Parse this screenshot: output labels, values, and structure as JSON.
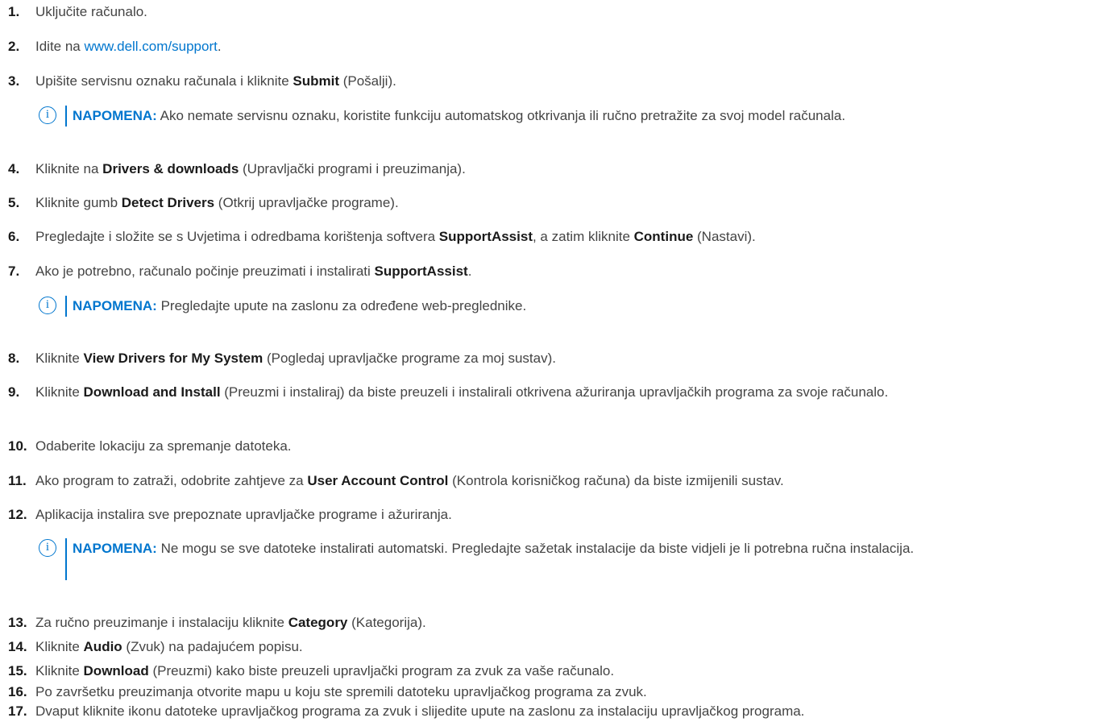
{
  "steps": [
    {
      "num": "1.",
      "parts": [
        {
          "t": "Uključite računalo."
        }
      ]
    },
    {
      "num": "2.",
      "parts": [
        {
          "t": "Idite na "
        },
        {
          "t": "www.dell.com/support",
          "s": "link"
        },
        {
          "t": "."
        }
      ]
    },
    {
      "num": "3.",
      "parts": [
        {
          "t": "Upišite servisnu oznaku računala i kliknite "
        },
        {
          "t": "Submit",
          "s": "b"
        },
        {
          "t": " (Pošalji)."
        }
      ]
    },
    {
      "num": "4.",
      "parts": [
        {
          "t": "Kliknite na "
        },
        {
          "t": "Drivers & downloads",
          "s": "b"
        },
        {
          "t": " (Upravljački programi i preuzimanja)."
        }
      ]
    },
    {
      "num": "5.",
      "parts": [
        {
          "t": "Kliknite gumb "
        },
        {
          "t": "Detect Drivers",
          "s": "b"
        },
        {
          "t": " (Otkrij upravljačke programe)."
        }
      ]
    },
    {
      "num": "6.",
      "parts": [
        {
          "t": "Pregledajte i složite se s Uvjetima i odredbama korištenja softvera "
        },
        {
          "t": "SupportAssist",
          "s": "b"
        },
        {
          "t": ", a zatim kliknite "
        },
        {
          "t": "Continue",
          "s": "b"
        },
        {
          "t": " (Nastavi)."
        }
      ]
    },
    {
      "num": "7.",
      "parts": [
        {
          "t": "Ako je potrebno, računalo počinje preuzimati i instalirati "
        },
        {
          "t": "SupportAssist",
          "s": "b"
        },
        {
          "t": "."
        }
      ]
    },
    {
      "num": "8.",
      "parts": [
        {
          "t": "Kliknite "
        },
        {
          "t": "View Drivers for My System",
          "s": "b"
        },
        {
          "t": " (Pogledaj upravljačke programe za moj sustav)."
        }
      ]
    },
    {
      "num": "9.",
      "parts": [
        {
          "t": "Kliknite "
        },
        {
          "t": "Download and Install",
          "s": "b"
        },
        {
          "t": " (Preuzmi i instaliraj) da biste preuzeli i instalirali otkrivena ažuriranja upravljačkih programa za svoje računalo."
        }
      ]
    },
    {
      "num": "10.",
      "parts": [
        {
          "t": "Odaberite lokaciju za spremanje datoteka."
        }
      ]
    },
    {
      "num": "11.",
      "parts": [
        {
          "t": "Ako program to zatraži, odobrite zahtjeve za "
        },
        {
          "t": "User Account Control",
          "s": "b"
        },
        {
          "t": " (Kontrola korisničkog računa) da biste izmijenili sustav."
        }
      ]
    },
    {
      "num": "12.",
      "parts": [
        {
          "t": "Aplikacija instalira sve prepoznate upravljačke programe i ažuriranja."
        }
      ]
    },
    {
      "num": "13.",
      "parts": [
        {
          "t": "Za ručno preuzimanje i instalaciju kliknite "
        },
        {
          "t": "Category",
          "s": "b"
        },
        {
          "t": " (Kategorija)."
        }
      ]
    },
    {
      "num": "14.",
      "parts": [
        {
          "t": "Kliknite "
        },
        {
          "t": "Audio",
          "s": "b"
        },
        {
          "t": " (Zvuk) na padajućem popisu."
        }
      ]
    },
    {
      "num": "15.",
      "parts": [
        {
          "t": "Kliknite "
        },
        {
          "t": "Download",
          "s": "b"
        },
        {
          "t": " (Preuzmi) kako biste preuzeli upravljački program za zvuk za vaše računalo."
        }
      ]
    },
    {
      "num": "16.",
      "parts": [
        {
          "t": "Po završetku preuzimanja otvorite mapu u koju ste spremili datoteku upravljačkog programa za zvuk."
        }
      ]
    },
    {
      "num": "17.",
      "parts": [
        {
          "t": "Dvaput kliknite ikonu datoteke upravljačkog programa za zvuk i slijedite upute na zaslonu za instalaciju upravljačkog programa."
        }
      ]
    }
  ],
  "notes": [
    {
      "label": "NAPOMENA:",
      "text": " Ako nemate servisnu oznaku, koristite funkciju automatskog otkrivanja ili ručno pretražite za svoj model računala."
    },
    {
      "label": "NAPOMENA:",
      "text": " Pregledajte upute na zaslonu za određene web-preglednike."
    },
    {
      "label": "NAPOMENA:",
      "text": " Ne mogu se sve datoteke instalirati automatski. Pregledajte sažetak instalacije da biste vidjeli je li potrebna ručna instalacija."
    }
  ],
  "note_icon": "info-circle-icon",
  "colors": {
    "accent": "#0076ce",
    "text": "#444444",
    "strong": "#1a1a1a"
  }
}
